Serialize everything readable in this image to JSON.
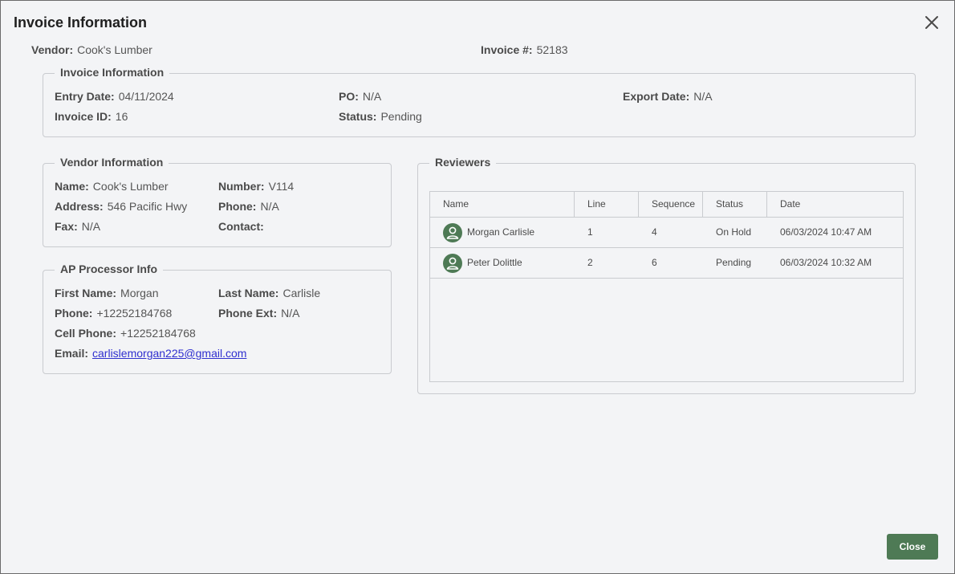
{
  "dialog": {
    "title": "Invoice Information"
  },
  "summary": {
    "vendor_label": "Vendor:",
    "vendor_value": "Cook's Lumber",
    "invoice_label": "Invoice #:",
    "invoice_value": "52183"
  },
  "invoice_info": {
    "legend": "Invoice Information",
    "entry_date_label": "Entry Date:",
    "entry_date_value": "04/11/2024",
    "po_label": "PO:",
    "po_value": "N/A",
    "export_date_label": "Export Date:",
    "export_date_value": "N/A",
    "invoice_id_label": "Invoice ID:",
    "invoice_id_value": "16",
    "status_label": "Status:",
    "status_value": "Pending"
  },
  "vendor_info": {
    "legend": "Vendor Information",
    "name_label": "Name:",
    "name_value": "Cook's Lumber",
    "number_label": "Number:",
    "number_value": "V114",
    "address_label": "Address:",
    "address_value": "546 Pacific Hwy",
    "phone_label": "Phone:",
    "phone_value": "N/A",
    "fax_label": "Fax:",
    "fax_value": "N/A",
    "contact_label": "Contact:",
    "contact_value": ""
  },
  "ap_info": {
    "legend": "AP Processor Info",
    "first_name_label": "First Name:",
    "first_name_value": "Morgan",
    "last_name_label": "Last Name:",
    "last_name_value": "Carlisle",
    "phone_label": "Phone:",
    "phone_value": "+12252184768",
    "phone_ext_label": "Phone Ext:",
    "phone_ext_value": "N/A",
    "cell_label": "Cell Phone:",
    "cell_value": "+12252184768",
    "email_label": "Email:",
    "email_value": "carlislemorgan225@gmail.com"
  },
  "reviewers": {
    "legend": "Reviewers",
    "columns": [
      "Name",
      "Line",
      "Sequence",
      "Status",
      "Date"
    ],
    "rows": [
      {
        "name": "Morgan Carlisle",
        "line": "1",
        "sequence": "4",
        "status": "On Hold",
        "date": "06/03/2024 10:47 AM",
        "avatar_icon": "user-icon"
      },
      {
        "name": "Peter Dolittle",
        "line": "2",
        "sequence": "6",
        "status": "Pending",
        "date": "06/03/2024 10:32 AM",
        "avatar_icon": "user-icon"
      }
    ]
  },
  "footer": {
    "close_label": "Close"
  },
  "colors": {
    "accent": "#4e7a55",
    "background": "#f3f4f6",
    "border": "#c9cbcf",
    "link": "#2f2fcf"
  }
}
